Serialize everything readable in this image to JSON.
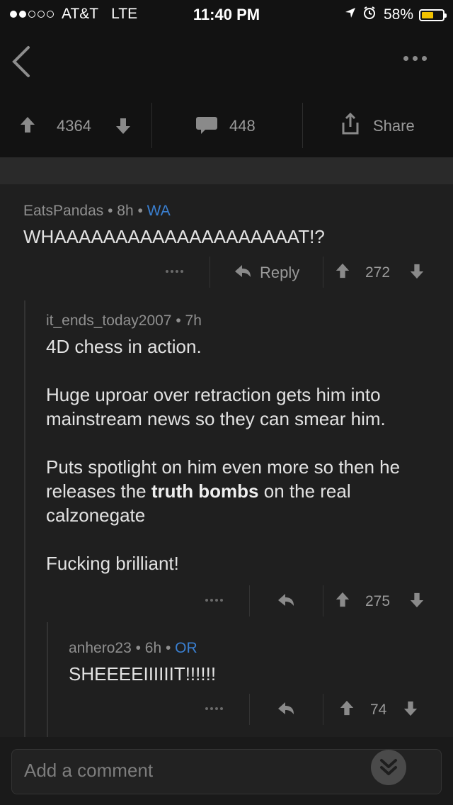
{
  "status_bar": {
    "carrier": "AT&T",
    "network": "LTE",
    "time": "11:40 PM",
    "battery": "58%",
    "battery_level": 0.58,
    "icons": [
      "signal-dots-icon",
      "location-arrow-icon",
      "alarm-icon",
      "battery-icon"
    ]
  },
  "post_actions": {
    "score": "4364",
    "comments": "448",
    "share_label": "Share"
  },
  "comments": [
    {
      "author": "EatsPandas",
      "age": "8h",
      "flair": "WA",
      "body": [
        "WHAAAAAAAAAAAAAAAAAAAAT!?"
      ],
      "reply_label": "Reply",
      "score": "272"
    },
    {
      "author": "it_ends_today2007",
      "age": "7h",
      "body_p1": "4D chess in action.",
      "body_p2": "Huge uproar over retraction gets him into mainstream news so they can smear him.",
      "body_p3_pre": "Puts spotlight on him even more so then he releases the ",
      "body_p3_bold": "truth bombs",
      "body_p3_post": " on the real calzonegate",
      "body_p4": "Fucking brilliant!",
      "score": "275"
    },
    {
      "author": "anhero23",
      "age": "6h",
      "flair": "OR",
      "body": [
        "SHEEEEIIIIIIT!!!!!!"
      ],
      "score": "74"
    }
  ],
  "input": {
    "placeholder": "Add a comment"
  },
  "colors": {
    "background": "#1f1f1f",
    "header": "#121212",
    "flair": "#3a7fd0",
    "battery": "#f2c200"
  }
}
